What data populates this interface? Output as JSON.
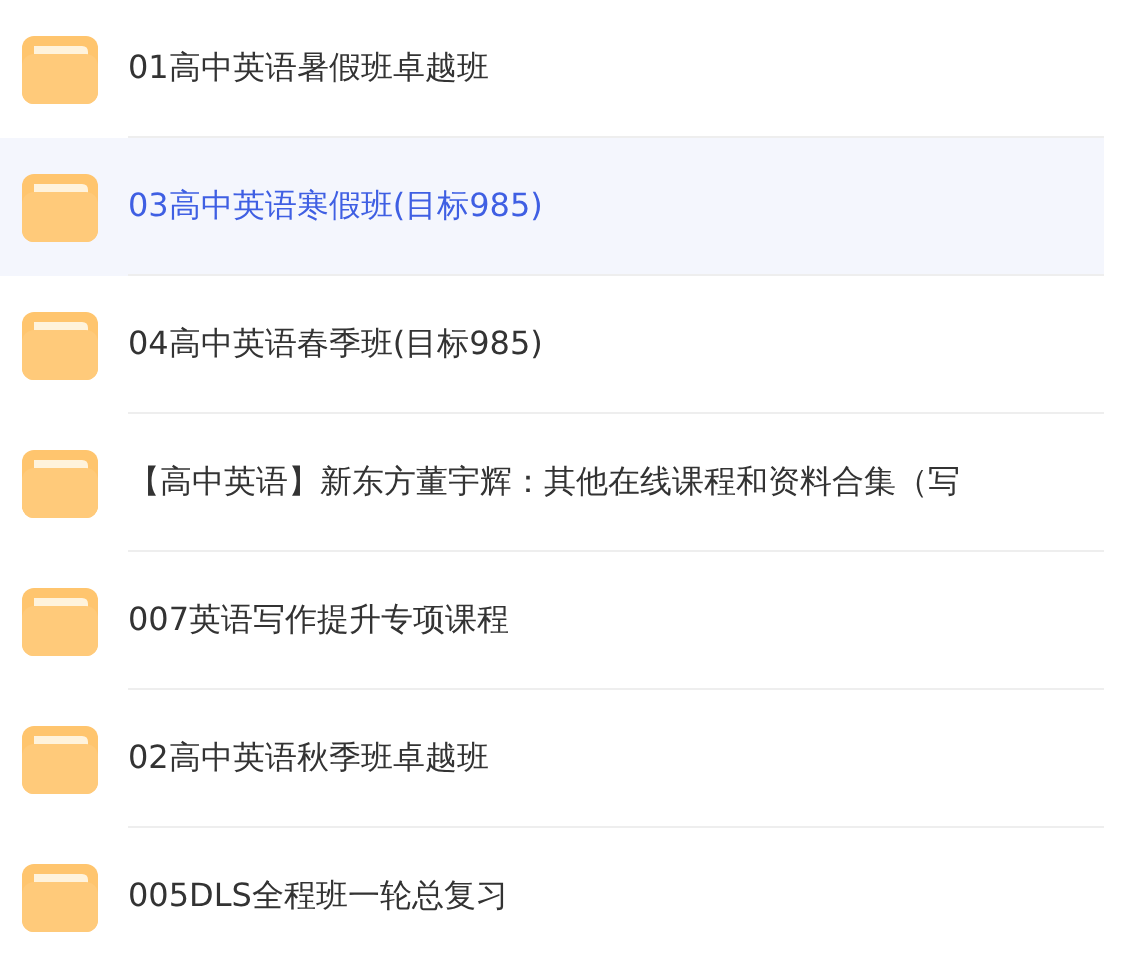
{
  "folders": [
    {
      "name": "01高中英语暑假班卓越班",
      "selected": false
    },
    {
      "name": "03高中英语寒假班(目标985)",
      "selected": true
    },
    {
      "name": "04高中英语春季班(目标985)",
      "selected": false
    },
    {
      "name": "【高中英语】新东方董宇辉：其他在线课程和资料合集（写",
      "selected": false
    },
    {
      "name": "007英语写作提升专项课程",
      "selected": false
    },
    {
      "name": "02高中英语秋季班卓越班",
      "selected": false
    },
    {
      "name": "005DLS全程班一轮总复习",
      "selected": false
    }
  ]
}
